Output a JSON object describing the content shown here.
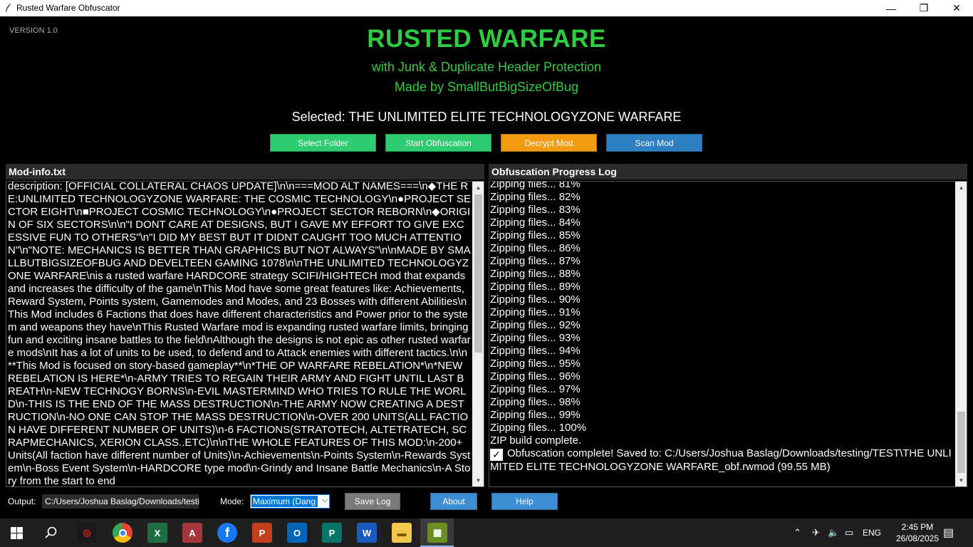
{
  "window": {
    "title": "Rusted Warfare Obfuscator",
    "minimize": "—",
    "maximize": "❐",
    "close": "✕"
  },
  "header": {
    "version": "VERSION 1.0",
    "title": "RUSTED WARFARE",
    "subtitle1": "with Junk & Duplicate Header Protection",
    "subtitle2": "Made by SmallButBigSizeOfBug",
    "selected": "Selected: THE UNLIMITED ELITE TECHNOLOGYZONE WARFARE"
  },
  "buttons": {
    "select_folder": "Select Folder",
    "start": "Start Obfuscation",
    "decrypt": "Decrypt Mod",
    "scan": "Scan Mod",
    "save_log": "Save Log",
    "about": "About",
    "help": "Help"
  },
  "colors": {
    "green_button": "#2ecc71",
    "orange_button": "#f39c12",
    "blue_button": "#2d7fc1",
    "help_button": "#3d8fd4",
    "title_green": "#2ecc40"
  },
  "modinfo": {
    "title": "Mod-info.txt",
    "text": "description: [OFFICIAL COLLATERAL CHAOS UPDATE]\\n\\n===MOD ALT NAMES===\\n◆THE RE:UNLIMITED TECHNOLOGYZONE WARFARE: THE COSMIC TECHNOLOGY\\n●PROJECT SECTOR EIGHT\\n■PROJECT COSMIC TECHNOLOGY\\n●PROJECT SECTOR REBORN\\n◆ORIGIN OF SIX SECTORS\\n\\n\"I DONT CARE AT DESIGNS, BUT I GAVE MY EFFORT TO GIVE EXCESSIVE FUN TO OTHERS\"\\n\"I DID MY BEST BUT IT DIDNT CAUGHT TOO MUCH ATTENTION\"\\n\"NOTE: MECHANICS IS BETTER THAN GRAPHICS BUT NOT ALWAYS\"\\n\\nMADE BY SMALLBUTBIGSIZEOFBUG AND DEVELTEEN GAMING 1078\\n\\nTHE UNLIMITED TECHNOLOGYZONE WARFARE\\nis a rusted warfare HARDCORE strategy SCIFI/HIGHTECH mod that expands and increases the difficulty of the game\\nThis Mod have some great features like: Achievements, Reward System, Points system, Gamemodes and Modes, and 23 Bosses with different Abilities\\nThis Mod includes 6 Factions that does have different characteristics and Power prior to the system and weapons they have\\nThis Rusted Warfare mod is expanding rusted warfare limits, bringing fun and exciting insane battles to the field\\nAlthough the designs is not epic as other rusted warfare mods\\nIt has a lot of units to be used, to defend and to Attack enemies with different tactics.\\n\\n**This Mod is focused on story-based gameplay**\\n*THE OP WARFARE REBELATION*\\n*NEW REBELATION IS HERE*\\n-ARMY TRIES TO REGAIN THEIR ARMY AND FIGHT UNTIL LAST BREATH\\n-NEW TECHNOGY BORNS\\n-EVIL MASTERMIND WHO TRIES TO RULE THE WORLD\\n-THIS IS THE END OF THE MASS DESTRUCTION\\n-THE ARMY NOW CREATING A DESTRUCTION\\n-NO ONE CAN STOP THE MASS DESTRUCTION\\n-OVER 200 UNITS(ALL FACTION HAVE DIFFERENT NUMBER OF UNITS)\\n-6 FACTIONS(STRATOTECH, ALTETRATECH, SCRAPMECHANICS, XERION CLASS..ETC)\\n\\nTHE WHOLE FEATURES OF THIS MOD:\\n-200+ Units(All faction have different number of Units)\\n-Achievements\\n-Points System\\n-Rewards System\\n-Boss Event System\\n-HARDCORE type mod\\n-Grindy and Insane Battle Mechanics\\n-A Story from the start to end"
  },
  "log": {
    "title": "Obfuscation Progress Log",
    "lines": [
      "Zipping files... 81%",
      "Zipping files... 82%",
      "Zipping files... 83%",
      "Zipping files... 84%",
      "Zipping files... 85%",
      "Zipping files... 86%",
      "Zipping files... 87%",
      "Zipping files... 88%",
      "Zipping files... 89%",
      "Zipping files... 90%",
      "Zipping files... 91%",
      "Zipping files... 92%",
      "Zipping files... 93%",
      "Zipping files... 94%",
      "Zipping files... 95%",
      "Zipping files... 96%",
      "Zipping files... 97%",
      "Zipping files... 98%",
      "Zipping files... 99%",
      "Zipping files... 100%",
      "ZIP build complete."
    ],
    "complete": "Obfuscation complete! Saved to: C:/Users/Joshua Baslag/Downloads/testing/TEST\\THE UNLIMITED ELITE TECHNOLOGYZONE WARFARE_obf.rwmod (99.55 MB)"
  },
  "footer": {
    "output_label": "Output:",
    "output_value": "C:/Users/Joshua Baslag/Downloads/testi",
    "mode_label": "Mode:",
    "mode_value": "Maximum (Dang"
  },
  "taskbar": {
    "apps": [
      "start",
      "search",
      "garena",
      "chrome",
      "excel",
      "access",
      "facebook",
      "powerpoint",
      "outlook",
      "publisher",
      "word",
      "file-explorer",
      "obfuscator"
    ],
    "lang": "ENG",
    "time": "2:45 PM",
    "date": "26/08/2025"
  }
}
